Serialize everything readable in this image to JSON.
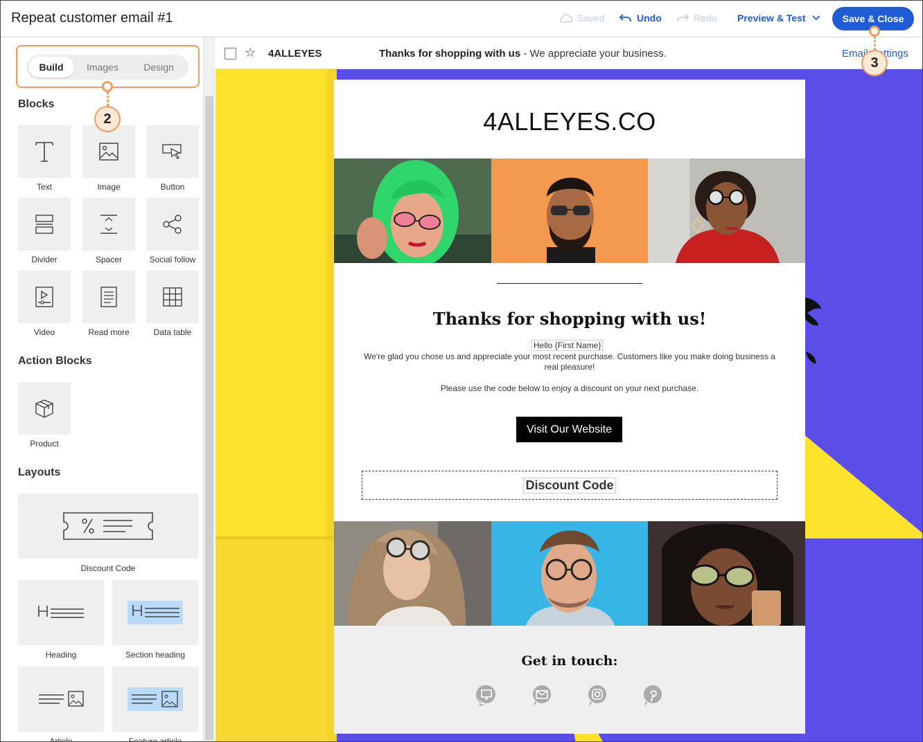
{
  "topbar": {
    "title": "Repeat customer email #1",
    "saved": "Saved",
    "undo": "Undo",
    "redo": "Redo",
    "preview": "Preview & Test",
    "save_close": "Save & Close"
  },
  "left_panel": {
    "tabs": [
      {
        "label": "Build",
        "active": true
      },
      {
        "label": "Images",
        "active": false
      },
      {
        "label": "Design",
        "active": false
      }
    ],
    "blocks_heading": "Blocks",
    "blocks": [
      {
        "label": "Text",
        "icon": "text-icon"
      },
      {
        "label": "Image",
        "icon": "image-icon"
      },
      {
        "label": "Button",
        "icon": "button-icon"
      },
      {
        "label": "Divider",
        "icon": "divider-icon"
      },
      {
        "label": "Spacer",
        "icon": "spacer-icon"
      },
      {
        "label": "Social follow",
        "icon": "share-icon"
      },
      {
        "label": "Video",
        "icon": "video-icon"
      },
      {
        "label": "Read more",
        "icon": "document-icon"
      },
      {
        "label": "Data table",
        "icon": "grid-icon"
      }
    ],
    "action_heading": "Action Blocks",
    "action_blocks": [
      {
        "label": "Product",
        "icon": "box-icon"
      }
    ],
    "layouts_heading": "Layouts",
    "layouts": [
      {
        "label": "Discount Code",
        "icon": "coupon-icon"
      },
      {
        "label": "Heading",
        "icon": "heading-icon"
      },
      {
        "label": "Section heading",
        "icon": "section-heading-icon"
      },
      {
        "label": "Article",
        "icon": "article-icon"
      },
      {
        "label": "Feature article",
        "icon": "feature-article-icon"
      }
    ]
  },
  "callouts": [
    "2",
    "3"
  ],
  "email_header": {
    "sender": "4ALLEYES",
    "subject_bold": "Thanks for shopping with us",
    "subject_rest": " - We appreciate your business.",
    "settings": "Email Settings"
  },
  "email": {
    "brand": "4ALLEYES.CO",
    "headline": "Thanks for shopping with us!",
    "greeting": "Hello {First Name}",
    "body": "We're glad you chose us and appreciate your most recent purchase. Customers like you make doing business a real pleasure!",
    "code_line": "Please use the code below to enjoy a discount on your next purchase.",
    "cta": "Visit Our Website",
    "discount": "Discount Code",
    "footer_heading": "Get in touch:",
    "social_icons": [
      "website-icon",
      "email-icon",
      "instagram-icon",
      "pinterest-icon"
    ]
  },
  "colors": {
    "accent": "#1f5cd6",
    "callout": "#f39b5a",
    "canvas_purple": "#5b4ee8",
    "canvas_yellow": "#fde22c"
  }
}
